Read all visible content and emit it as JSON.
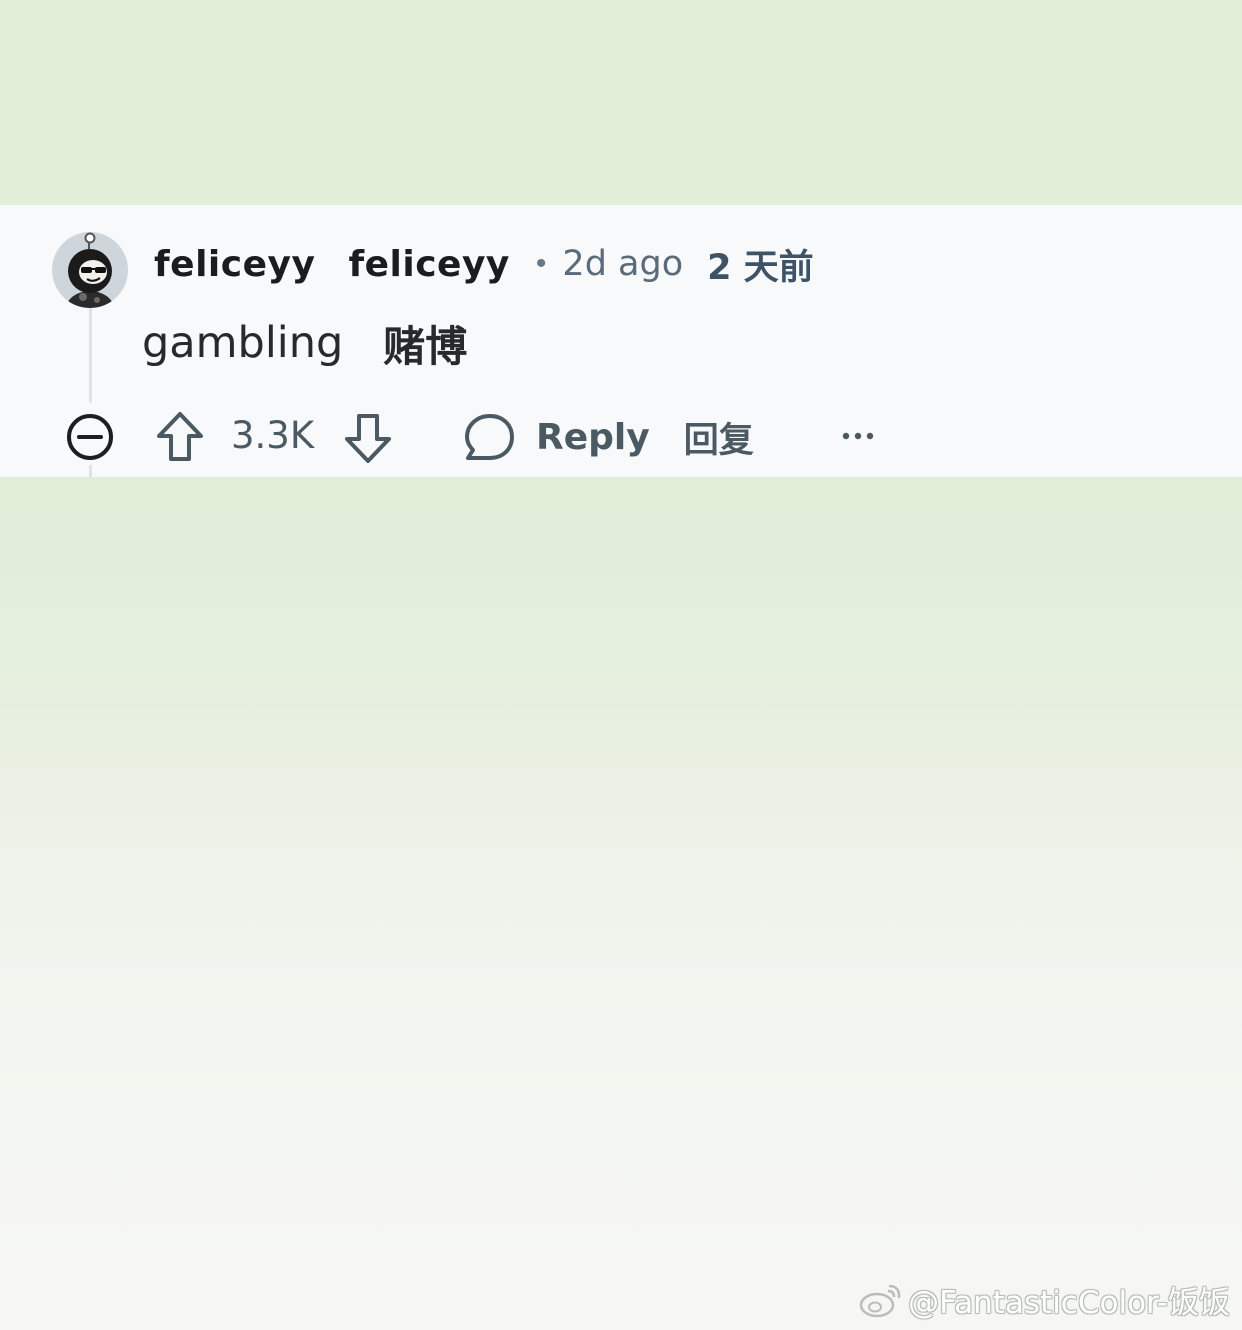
{
  "comment": {
    "username": "feliceyy",
    "username_translated": "feliceyy",
    "separator": "•",
    "timestamp": "2d ago",
    "timestamp_translated": "2 天前",
    "text": "gambling",
    "text_translated": "赌博"
  },
  "actions": {
    "vote_count": "3.3K",
    "reply_label": "Reply",
    "reply_translated": "回复"
  },
  "icons": {
    "collapse": "minus-circle-icon",
    "upvote": "arrow-up-icon",
    "downvote": "arrow-down-icon",
    "reply": "speech-bubble-icon",
    "more": "ellipsis-icon",
    "watermark": "weibo-icon"
  },
  "colors": {
    "background": "#e1efd9",
    "card": "#f7f9fa",
    "username": "#1a1c1e",
    "meta": "#5b6b79",
    "action": "#4b5963"
  },
  "watermark": {
    "text": "@FantasticColor-饭饭"
  }
}
